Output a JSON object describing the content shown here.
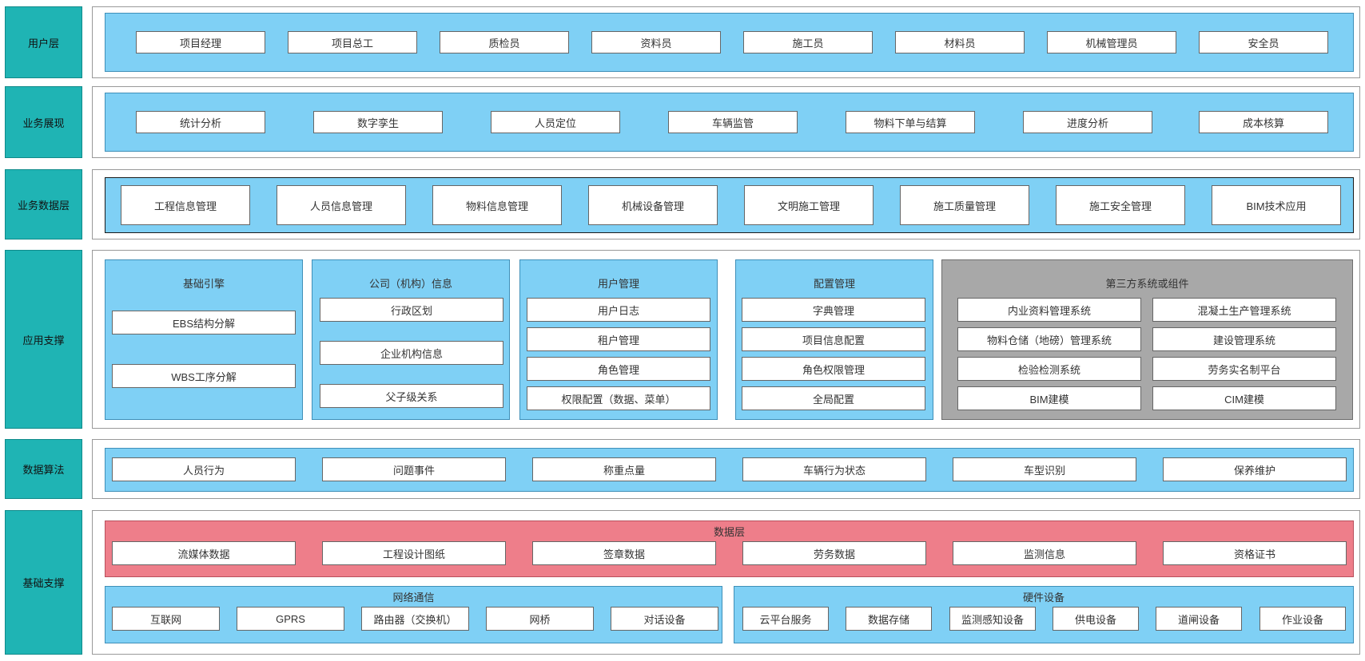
{
  "rows": {
    "user_layer": {
      "label": "用户层",
      "items": [
        "项目经理",
        "项目总工",
        "质检员",
        "资料员",
        "施工员",
        "材料员",
        "机械管理员",
        "安全员"
      ]
    },
    "business_display": {
      "label": "业务展现",
      "items": [
        "统计分析",
        "数字孪生",
        "人员定位",
        "车辆监管",
        "物料下单与结算",
        "进度分析",
        "成本核算"
      ]
    },
    "business_data": {
      "label": "业务数据层",
      "items": [
        "工程信息管理",
        "人员信息管理",
        "物料信息管理",
        "机械设备管理",
        "文明施工管理",
        "施工质量管理",
        "施工安全管理",
        "BIM技术应用"
      ]
    },
    "app_support": {
      "label": "应用支撑",
      "groups": [
        {
          "title": "基础引擎",
          "items": [
            "EBS结构分解",
            "WBS工序分解"
          ]
        },
        {
          "title": "公司（机构）信息",
          "items": [
            "行政区划",
            "企业机构信息",
            "父子级关系"
          ]
        },
        {
          "title": "用户管理",
          "items": [
            "用户日志",
            "租户管理",
            "角色管理",
            "权限配置（数据、菜单）"
          ]
        },
        {
          "title": "配置管理",
          "items": [
            "字典管理",
            "项目信息配置",
            "角色权限管理",
            "全局配置"
          ]
        },
        {
          "title": "第三方系统或组件",
          "items": [
            "内业资料管理系统",
            "混凝土生产管理系统",
            "物料仓储（地磅）管理系统",
            "建设管理系统",
            "检验检测系统",
            "劳务实名制平台",
            "BIM建模",
            "CIM建模"
          ]
        }
      ]
    },
    "data_algorithm": {
      "label": "数据算法",
      "items": [
        "人员行为",
        "问题事件",
        "称重点量",
        "车辆行为状态",
        "车型识别",
        "保养维护"
      ]
    },
    "base_support": {
      "label": "基础支撑",
      "data_layer": {
        "title": "数据层",
        "items": [
          "流媒体数据",
          "工程设计图纸",
          "签章数据",
          "劳务数据",
          "监测信息",
          "资格证书"
        ]
      },
      "network": {
        "title": "网络通信",
        "items": [
          "互联网",
          "GPRS",
          "路由器（交换机）",
          "网桥",
          "对话设备"
        ]
      },
      "hardware": {
        "title": "硬件设备",
        "items": [
          "云平台服务",
          "数据存储",
          "监测感知设备",
          "供电设备",
          "道闸设备",
          "作业设备"
        ]
      }
    }
  },
  "colors": {
    "label_bg": "#1fb4b4",
    "panel_blue": "#7fd0f5",
    "panel_pink": "#ee7e8a",
    "panel_gray": "#a8a8a8"
  }
}
